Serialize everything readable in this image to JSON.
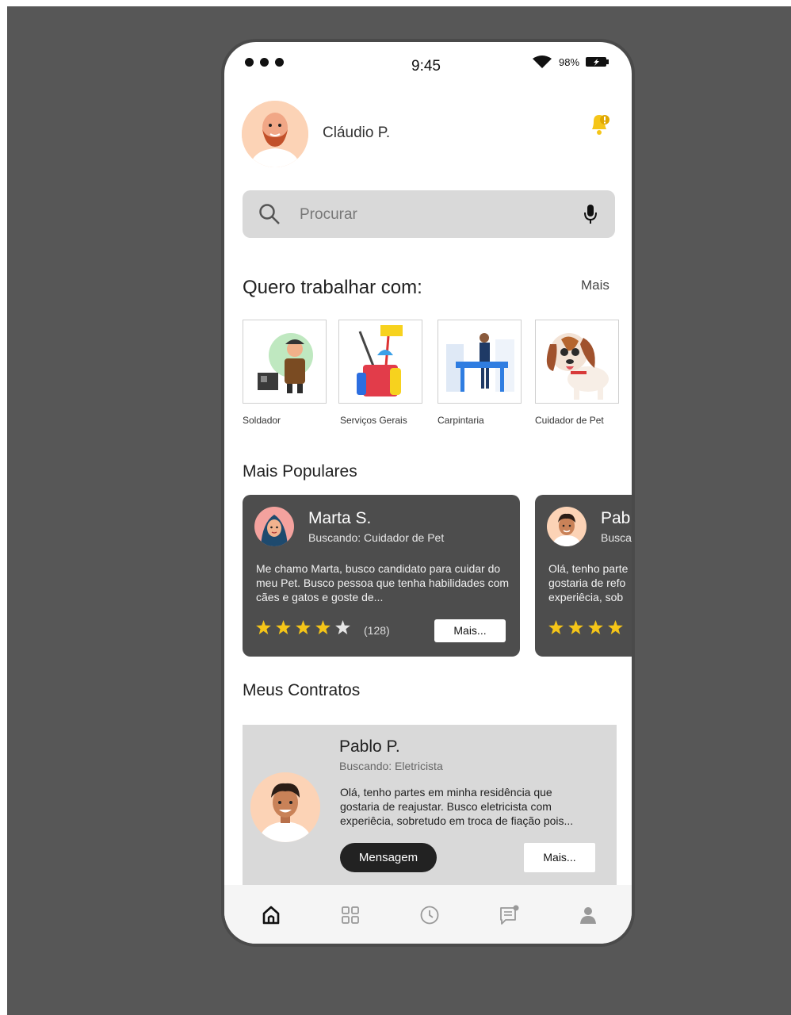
{
  "status_bar": {
    "time": "9:45",
    "battery": "98%"
  },
  "header": {
    "user_name": "Cláudio P."
  },
  "search": {
    "placeholder": "Procurar"
  },
  "categories": {
    "title": "Quero trabalhar com:",
    "more_label": "Mais",
    "items": [
      {
        "label": "Soldador"
      },
      {
        "label": "Serviços Gerais"
      },
      {
        "label": "Carpintaria"
      },
      {
        "label": "Cuidador de Pet"
      }
    ]
  },
  "popular": {
    "title": "Mais Populares",
    "cards": [
      {
        "name": "Marta S.",
        "subtitle": "Buscando: Cuidador de Pet",
        "description": "Me chamo Marta, busco candidato para cuidar do meu Pet. Busco pessoa que tenha habilidades com cães e gatos e goste de...",
        "rating": 4,
        "review_count": "(128)",
        "more_label": "Mais..."
      },
      {
        "name": "Pab",
        "subtitle": "Busca",
        "description": "Olá, tenho parte gostaria de refo experiêcia, sob",
        "rating": 4
      }
    ]
  },
  "contracts": {
    "title": "Meus Contratos",
    "items": [
      {
        "name": "Pablo P.",
        "subtitle": "Buscando: Eletricista",
        "description": "Olá, tenho partes em minha residência que gostaria de reajustar. Busco eletricista com experiêcia, sobretudo em troca de fiação pois...",
        "message_label": "Mensagem",
        "more_label": "Mais..."
      }
    ]
  },
  "nav": {
    "items": [
      {
        "icon": "home-icon",
        "active": true
      },
      {
        "icon": "grid-icon"
      },
      {
        "icon": "clock-icon"
      },
      {
        "icon": "chat-icon"
      },
      {
        "icon": "user-icon"
      }
    ]
  },
  "colors": {
    "backdrop": "#575757",
    "card_dark": "#4d4d4d",
    "search_bg": "#d9d9d9",
    "star": "#f5c518",
    "bell": "#f5c518"
  }
}
